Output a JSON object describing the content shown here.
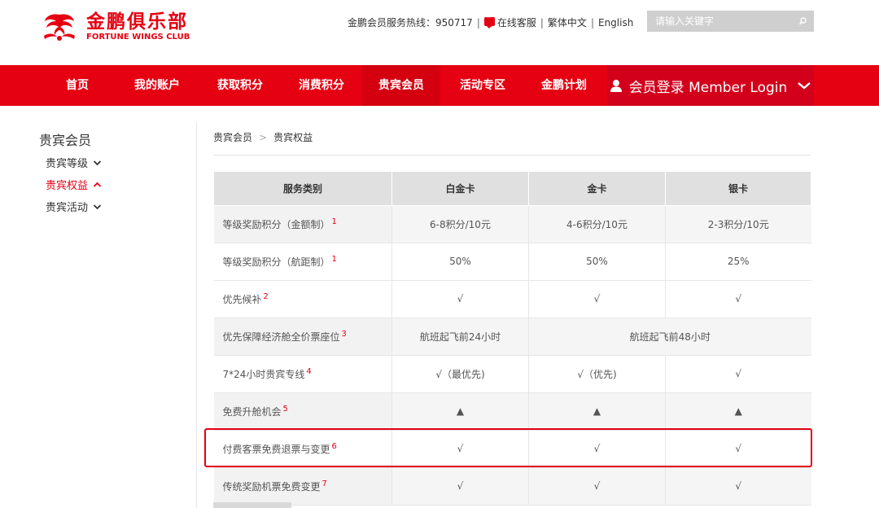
{
  "brand": {
    "name_cn": "金鹏俱乐部",
    "name_en": "FORTUNE WINGS CLUB",
    "color": "#e50012"
  },
  "topbar": {
    "hotline": "金鹏会员服务热线：950717",
    "online_service": "在线客服",
    "trad_chinese": "繁体中文",
    "english": "English",
    "search_placeholder": "请输入关键字"
  },
  "nav": {
    "items": [
      {
        "label": "首页"
      },
      {
        "label": "我的账户"
      },
      {
        "label": "获取积分"
      },
      {
        "label": "消费积分"
      },
      {
        "label": "贵宾会员",
        "active": true
      },
      {
        "label": "活动专区"
      },
      {
        "label": "金鹏计划"
      }
    ],
    "login": "会员登录 Member Login"
  },
  "sidebar": {
    "title": "贵宾会员",
    "items": [
      {
        "label": "贵宾等级",
        "icon": "chevron-down-icon"
      },
      {
        "label": "贵宾权益",
        "icon": "chevron-up-icon",
        "active": true
      },
      {
        "label": "贵宾活动",
        "icon": "chevron-down-icon"
      }
    ]
  },
  "breadcrumb": {
    "items": [
      "贵宾会员",
      "贵宾权益"
    ],
    "separator": ">"
  },
  "table": {
    "headers": [
      "服务类别",
      "白金卡",
      "金卡",
      "银卡"
    ],
    "rows": [
      {
        "label": "等级奖励积分（金额制）",
        "note": "1",
        "cells": [
          "6-8积分/10元",
          "4-6积分/10元",
          "2-3积分/10元"
        ]
      },
      {
        "label": "等级奖励积分（航距制）",
        "note": "1",
        "cells": [
          "50%",
          "50%",
          "25%"
        ]
      },
      {
        "label": "优先候补",
        "note": "2",
        "cells": [
          "√",
          "√",
          "√"
        ]
      },
      {
        "label": "优先保障经济舱全价票座位",
        "note": "3",
        "cells": [
          "航班起飞前24小时",
          "航班起飞前48小时"
        ]
      },
      {
        "label": "7*24小时贵宾专线",
        "note": "4",
        "cells": [
          "√（最优先)",
          "√（优先)",
          "√"
        ]
      },
      {
        "label": "免费升舱机会",
        "note": "5",
        "cells": [
          "▲",
          "▲",
          "▲"
        ]
      },
      {
        "label": "付费客票免费退票与变更",
        "note": "6",
        "cells": [
          "√",
          "√",
          "√"
        ]
      },
      {
        "label": "传统奖励机票免费变更",
        "note": "7",
        "cells": [
          "√",
          "√",
          "√"
        ]
      }
    ]
  }
}
